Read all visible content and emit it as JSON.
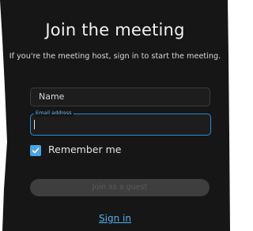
{
  "dialog": {
    "title": "Join the meeting",
    "subtitle": "If you're the meeting host, sign in to start the meeting."
  },
  "form": {
    "name_placeholder": "Name",
    "email_label": "Email address",
    "email_value": "",
    "remember_label": "Remember me",
    "remember_checked": true,
    "guest_button_label": "Join as a guest",
    "guest_button_enabled": false
  },
  "footer": {
    "sign_in_label": "Sign in"
  },
  "colors": {
    "background": "#161616",
    "accent": "#1f8fd6",
    "link": "#4fb1f0",
    "checkbox": "#4aa3e4"
  },
  "icons": {
    "checkbox_mark": "checkmark-icon"
  }
}
